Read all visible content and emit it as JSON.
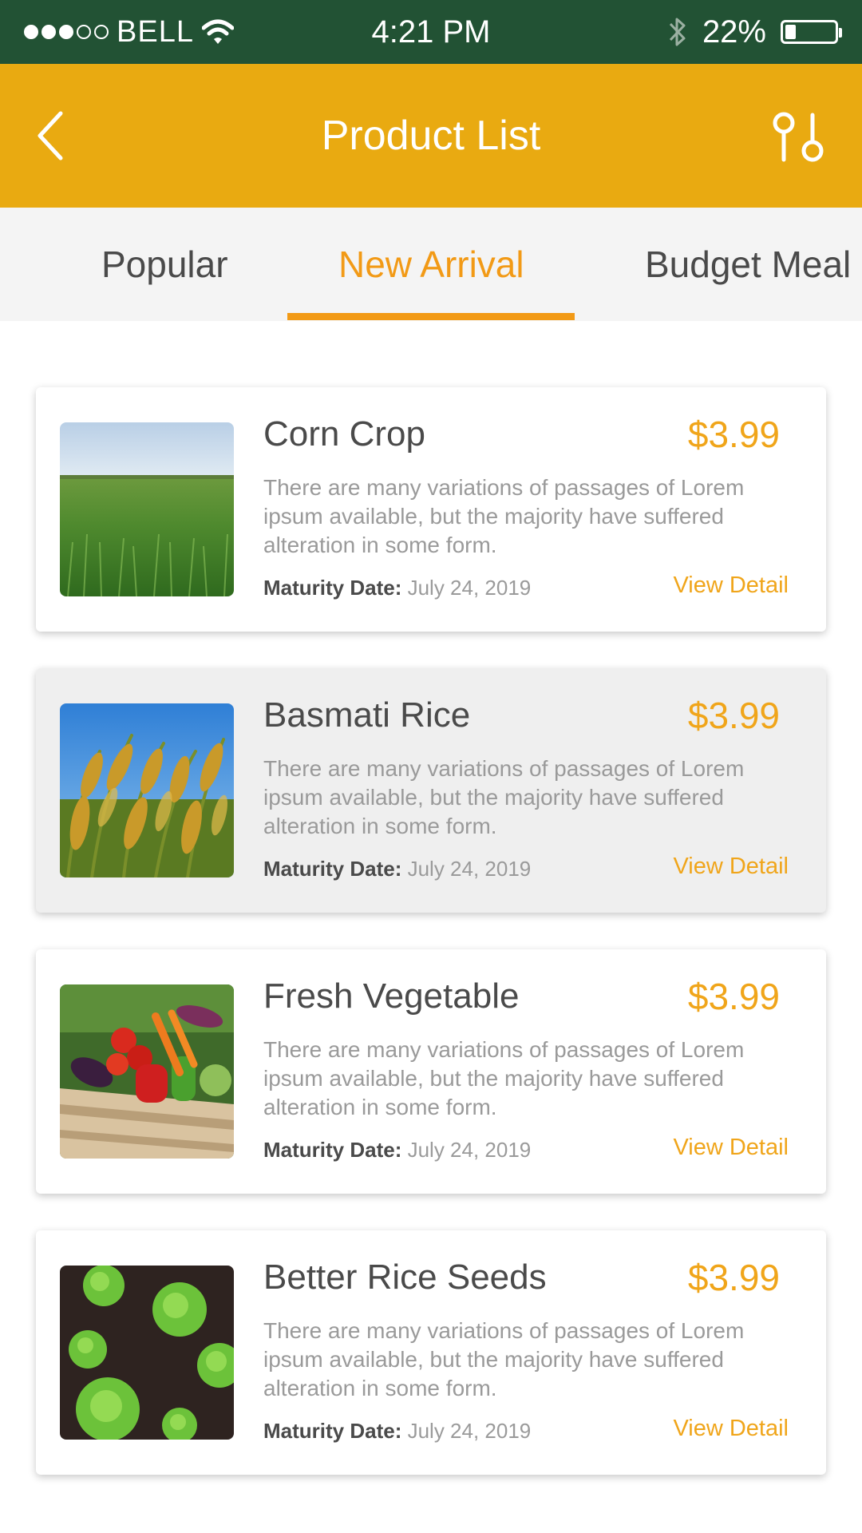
{
  "status_bar": {
    "carrier": "BELL",
    "time": "4:21 PM",
    "battery_percent": "22%",
    "battery_level": 0.22,
    "signal_strength": 3,
    "icons": [
      "signal-dots-icon",
      "wifi-icon",
      "bluetooth-icon",
      "battery-icon"
    ]
  },
  "header": {
    "title": "Product List",
    "back_icon": "chevron-left-icon",
    "filter_icon": "filter-icon"
  },
  "tabs": [
    {
      "label": "Popular",
      "active": false
    },
    {
      "label": "New Arrival",
      "active": true
    },
    {
      "label": "Budget Meal",
      "active": false
    }
  ],
  "colors": {
    "status_bar": "#225234",
    "header": "#e9aa11",
    "accent": "#f29a16",
    "price": "#f0a51a"
  },
  "products": [
    {
      "title": "Corn Crop",
      "price": "$3.99",
      "description": "There are many variations of passages of Lorem ipsum available, but the majority have suffered alteration in some form.",
      "maturity_label": "Maturity Date:",
      "maturity_date": "July 24, 2019",
      "action": "View Detail",
      "image": "green-field-image"
    },
    {
      "title": "Basmati Rice",
      "price": "$3.99",
      "description": "There are many variations of passages of Lorem ipsum available, but the majority have suffered alteration in some form.",
      "maturity_label": "Maturity Date:",
      "maturity_date": "July 24, 2019",
      "action": "View Detail",
      "image": "rice-plant-image"
    },
    {
      "title": "Fresh Vegetable",
      "price": "$3.99",
      "description": "There are many variations of passages of Lorem ipsum available, but the majority have suffered alteration in some form.",
      "maturity_label": "Maturity Date:",
      "maturity_date": "July 24, 2019",
      "action": "View Detail",
      "image": "vegetable-crate-image"
    },
    {
      "title": "Better Rice Seeds",
      "price": "$3.99",
      "description": "There are many variations of passages of Lorem ipsum available, but the majority have suffered alteration in some form.",
      "maturity_label": "Maturity Date:",
      "maturity_date": "July 24, 2019",
      "action": "View Detail",
      "image": "lettuce-soil-image"
    }
  ]
}
